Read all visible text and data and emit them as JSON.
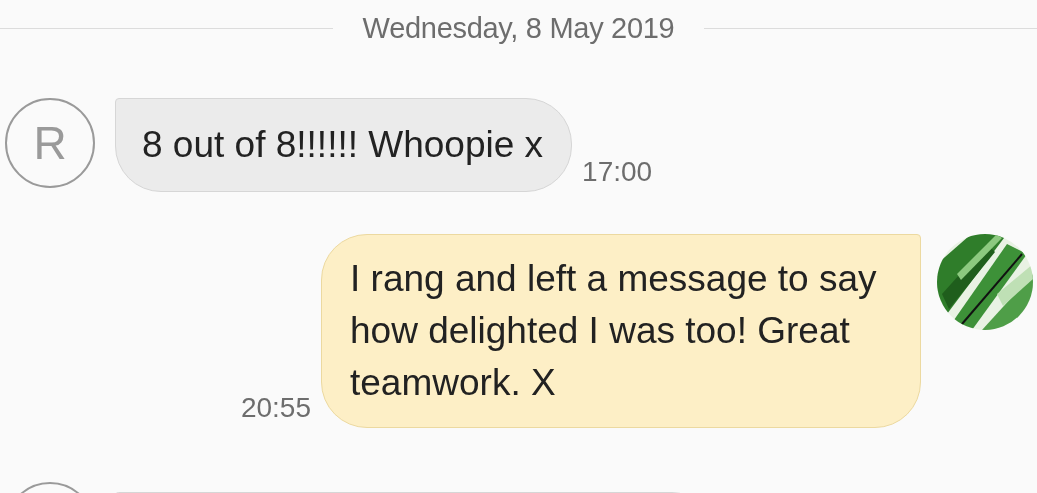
{
  "date_header": "Wednesday, 8 May 2019",
  "messages": [
    {
      "kind": "received",
      "avatar": {
        "kind": "letter",
        "letter": "R"
      },
      "text": "8 out of 8!!!!!! Whoopie x",
      "time": "17:00"
    },
    {
      "kind": "sent",
      "text": "I rang and left a message to say how delighted I was too! Great teamwork. X",
      "time": "20:55"
    },
    {
      "kind": "received",
      "avatar": {
        "kind": "letter"
      }
    }
  ]
}
